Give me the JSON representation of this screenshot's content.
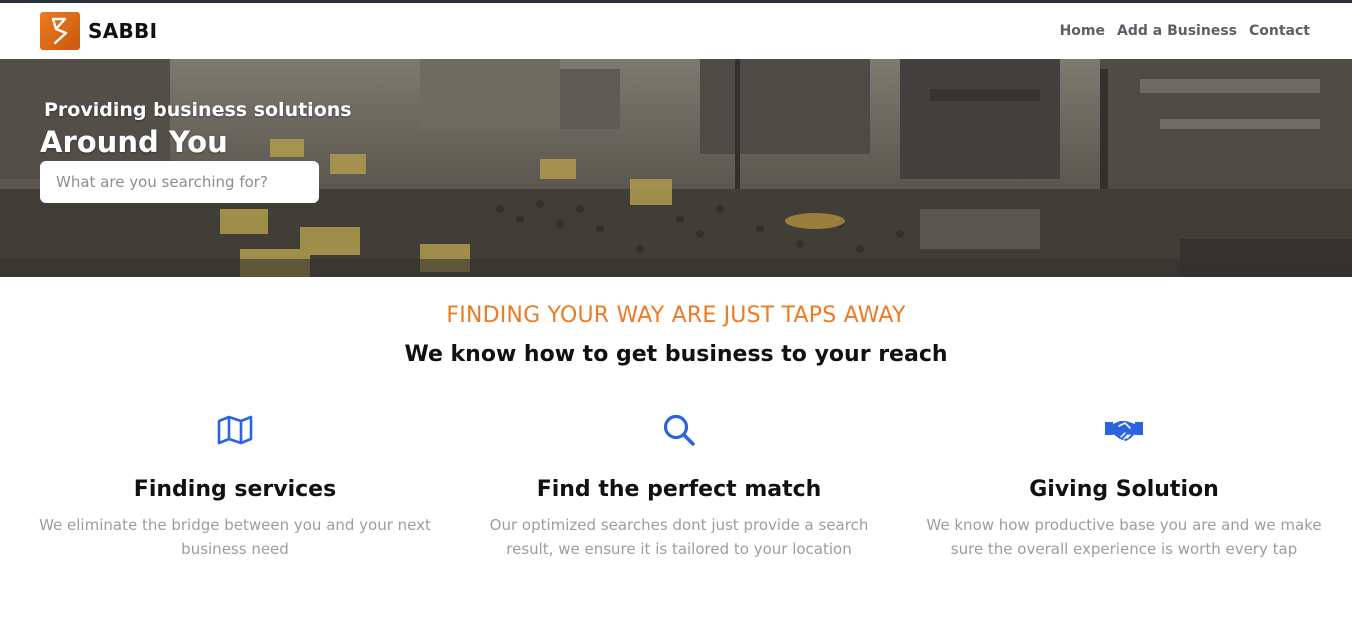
{
  "navbar": {
    "brand": "SABBI",
    "links": [
      "Home",
      "Add a Business",
      "Contact"
    ]
  },
  "hero": {
    "subtitle": "Providing business solutions",
    "title": "Around You",
    "search_placeholder": "What are you searching for?"
  },
  "intro": {
    "tagline": "FINDING YOUR WAY ARE JUST TAPS AWAY",
    "headline": "We know how to get business to your reach"
  },
  "features": [
    {
      "icon": "map-icon",
      "title": "Finding services",
      "text": "We eliminate the bridge between you and your next business need"
    },
    {
      "icon": "search-icon",
      "title": "Find the perfect match",
      "text": "Our optimized searches dont just provide a search result, we ensure it is tailored to your location"
    },
    {
      "icon": "handshake-icon",
      "title": "Giving Solution",
      "text": "We know how productive base you are and we make sure the overall experience is worth every tap"
    }
  ],
  "colors": {
    "accent": "#ef7a22",
    "icon_blue": "#2b63e3",
    "muted_text": "#9a9da3"
  }
}
